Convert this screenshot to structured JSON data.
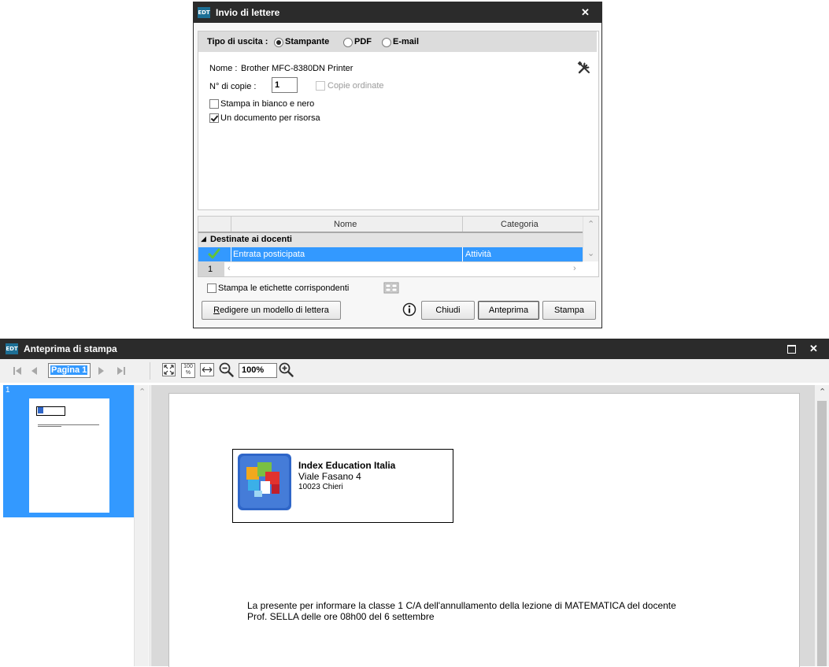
{
  "dialog": {
    "title": "Invio di lettere",
    "app_badge": "EDT",
    "close_glyph": "✕",
    "output_label": "Tipo di uscita :",
    "output_options": [
      "Stampante",
      "PDF",
      "E-mail"
    ],
    "output_selected": "Stampante",
    "name_label": "Nome :",
    "printer_name": "Brother MFC-8380DN Printer",
    "copies_label": "N° di copie :",
    "copies_value": "1",
    "collate_label": "Copie ordinate",
    "bw_label": "Stampa in bianco e nero",
    "per_resource_label": "Un documento per risorsa",
    "table": {
      "columns": [
        "Nome",
        "Categoria"
      ],
      "group": "Destinate ai docenti",
      "rows": [
        {
          "nome": "Entrata posticipata",
          "categoria": "Attività"
        }
      ],
      "count": "1"
    },
    "labels_checkbox": "Stampa le etichette corrispondenti",
    "buttons": {
      "edit_template": "Redigere un modello di lettera",
      "edit_template_mnemonic": "R",
      "edit_template_rest": "edigere un modello di lettera",
      "close": "Chiudi",
      "preview": "Anteprima",
      "print": "Stampa"
    }
  },
  "preview": {
    "title": "Anteprima di stampa",
    "app_badge": "EDT",
    "page_field": "Pagina 1",
    "zoom_value": "100%",
    "zoom_fit_label": "100\n%",
    "thumbnail_number": "1",
    "letter": {
      "sender_name": "Index Education Italia",
      "sender_street": "Viale Fasano 4",
      "sender_city": "10023 Chieri",
      "body_line1": "La presente per informare la classe  1 C/A dell'annullamento della lezione di MATEMATICA del docente",
      "body_line2": "Prof. SELLA  delle ore  08h00 del  6 settembre"
    }
  },
  "icons": {
    "tools": "wrench-screwdriver-icon",
    "info": "info-icon",
    "labels": "label-sheet-icon",
    "check": "green-check-icon",
    "first_page": "first-page-icon",
    "prev_page": "prev-page-icon",
    "next_page": "next-page-icon",
    "last_page": "last-page-icon",
    "fit_page": "fit-page-icon",
    "actual_size": "actual-size-icon",
    "fit_width": "fit-width-icon",
    "zoom_out": "zoom-out-icon",
    "zoom_in": "zoom-in-icon",
    "maximize": "maximize-icon",
    "close": "close-icon"
  },
  "colors": {
    "titlebar": "#2b2b2b",
    "selection": "#3399ff",
    "badge": "#1d6f95",
    "check": "#62c33a"
  }
}
